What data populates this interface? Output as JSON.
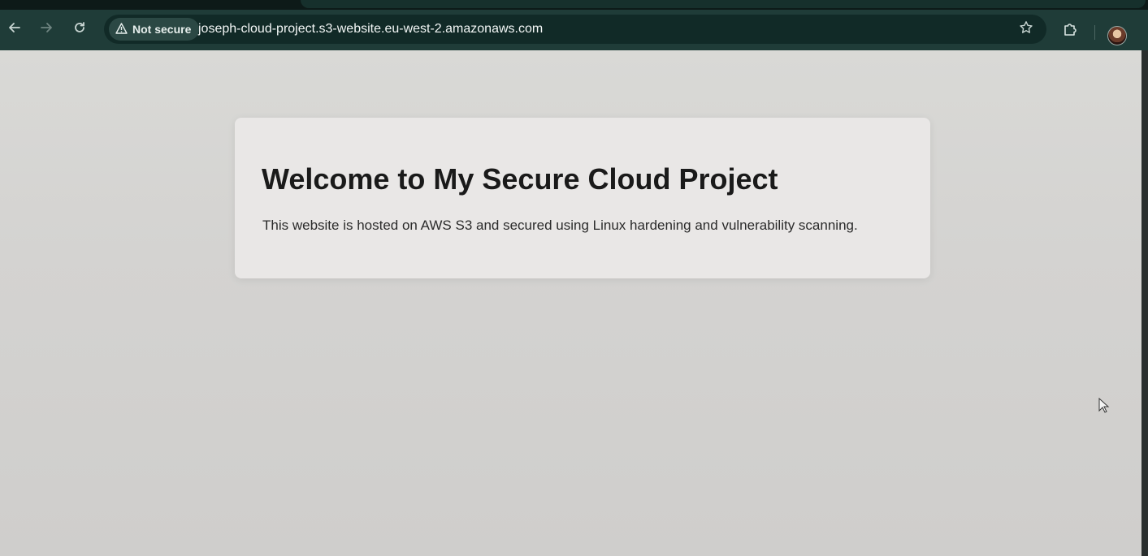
{
  "browser": {
    "nav": {
      "back_icon": "arrow-left-icon",
      "forward_icon": "arrow-right-icon",
      "reload_icon": "reload-icon"
    },
    "security_label": "Not secure",
    "url": "joseph-cloud-project.s3-website.eu-west-2.amazonaws.com",
    "bookmark_icon": "star-icon",
    "extensions_icon": "puzzle-icon",
    "profile_icon": "avatar"
  },
  "page": {
    "heading": "Welcome to My Secure Cloud Project",
    "body": "This website is hosted on AWS S3 and secured using Linux hardening and vulnerability scanning."
  },
  "colors": {
    "toolbar": "#1f3c38",
    "omnibox": "#112a27",
    "page_bg": "#d4d3d1",
    "card_bg": "#e9e7e6"
  }
}
